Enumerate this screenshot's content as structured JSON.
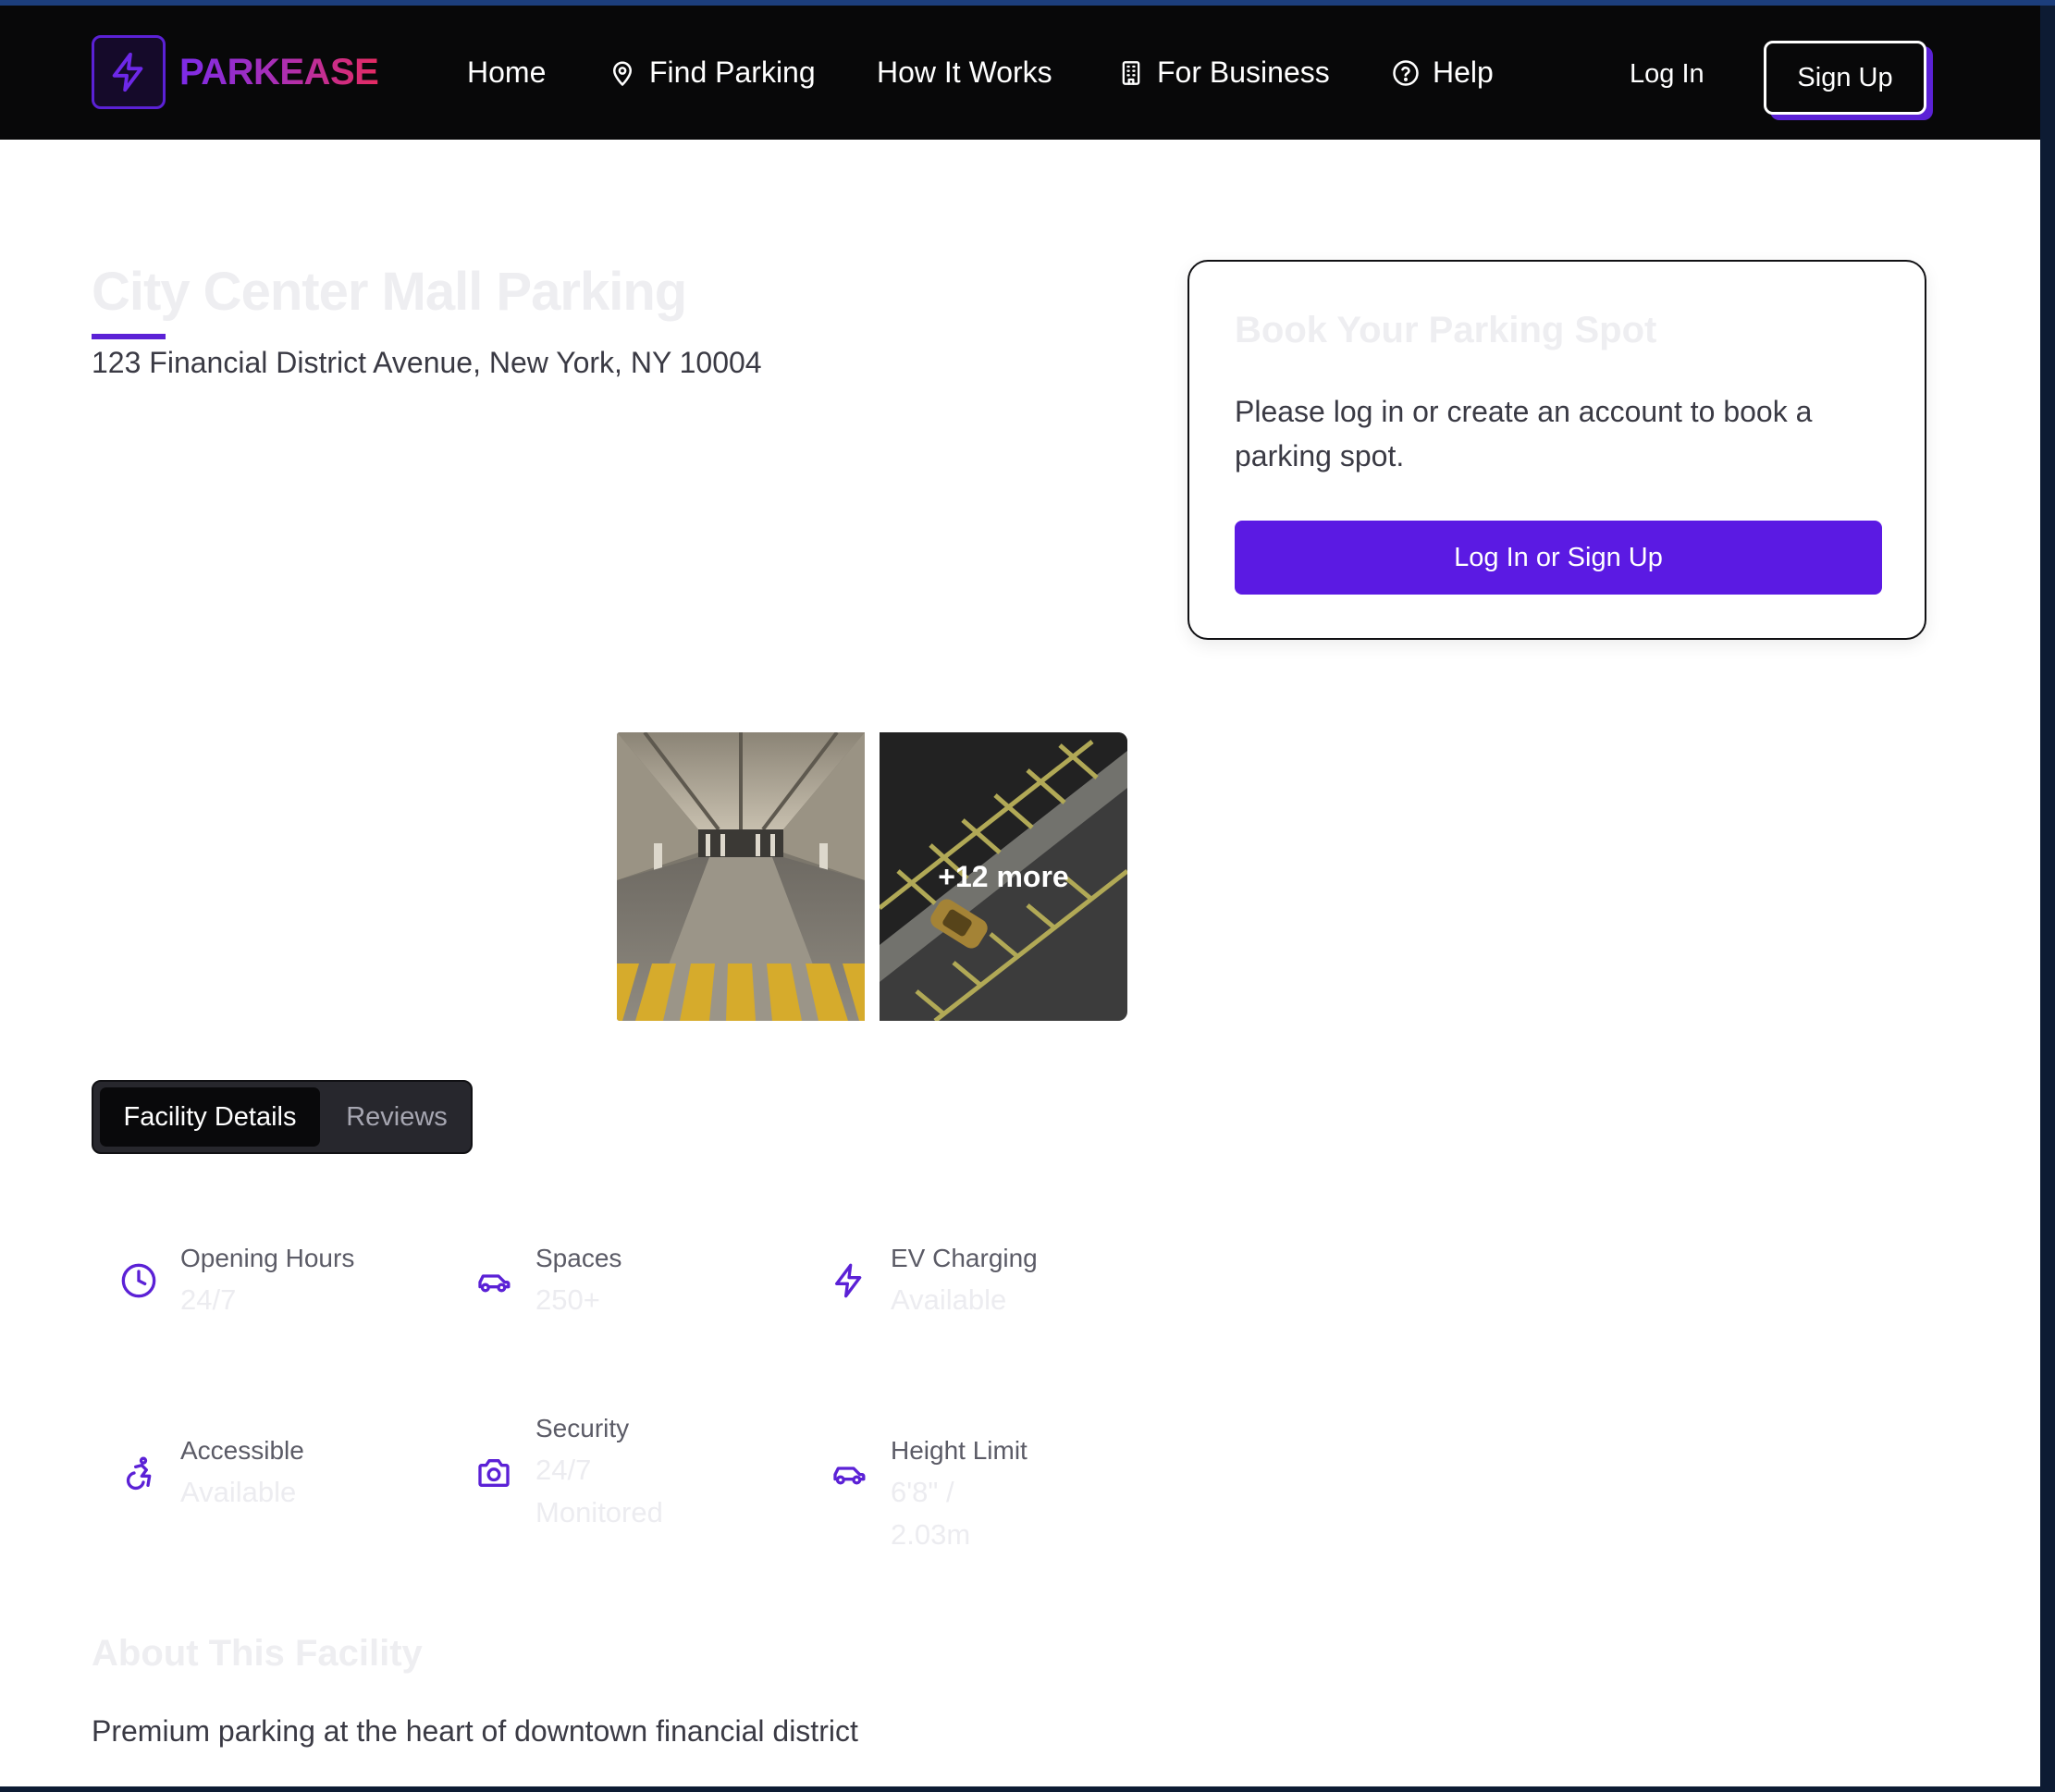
{
  "brand": {
    "name": "PARKEASE",
    "accent": "#5b21d6",
    "gradient": [
      "#7c2be8",
      "#e52b62"
    ]
  },
  "nav": {
    "home": "Home",
    "find_parking": "Find Parking",
    "how_it_works": "How It Works",
    "for_business": "For Business",
    "help": "Help",
    "log_in": "Log In",
    "sign_up": "Sign Up"
  },
  "facility": {
    "title": "City Center Mall Parking",
    "address": "123 Financial District Avenue, New York, NY 10004"
  },
  "booking": {
    "title": "Book Your Parking Spot",
    "message": "Please log in or create an account to book a parking spot.",
    "button": "Log In or Sign Up"
  },
  "gallery": {
    "more_label": "+12 more"
  },
  "tabs": {
    "details": "Facility Details",
    "reviews": "Reviews"
  },
  "details": [
    {
      "icon": "clock-icon",
      "label": "Opening Hours",
      "value": "24/7"
    },
    {
      "icon": "car-icon",
      "label": "Spaces",
      "value": "250+"
    },
    {
      "icon": "lightning-icon",
      "label": "EV Charging",
      "value": "Available"
    },
    {
      "icon": "accessibility-icon",
      "label": "Accessible",
      "value": "Available"
    },
    {
      "icon": "camera-icon",
      "label": "Security",
      "value": "24/7 Monitored"
    },
    {
      "icon": "car-icon",
      "label": "Height Limit",
      "value": "6'8\" / 2.03m"
    }
  ],
  "about": {
    "title": "About This Facility",
    "text": "Premium parking at the heart of downtown financial district"
  }
}
